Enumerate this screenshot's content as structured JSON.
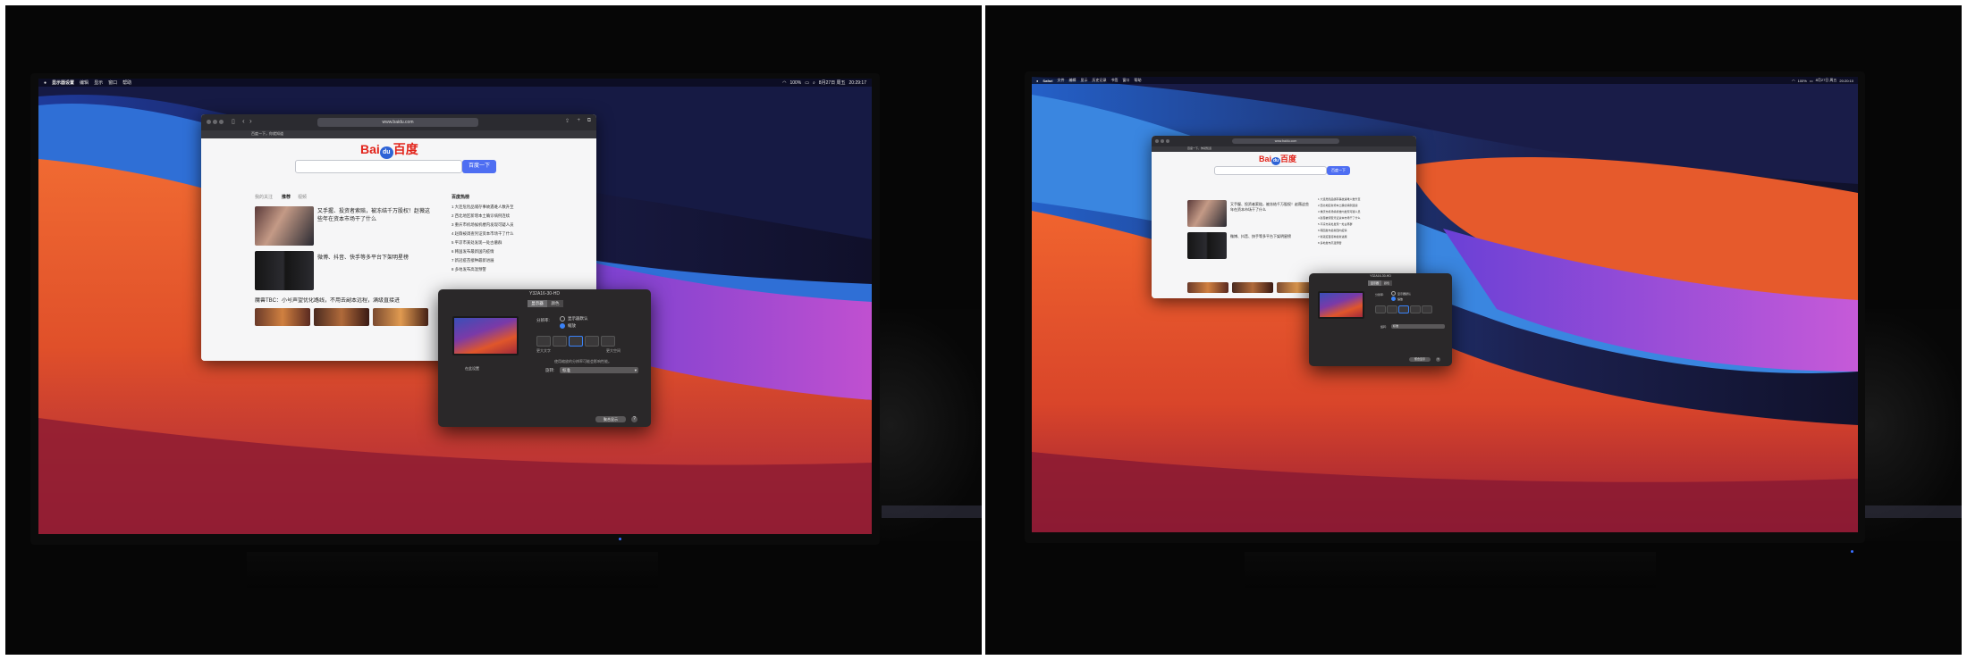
{
  "photos": [
    {
      "id": "left",
      "menubar": {
        "apple_icon": "apple-icon",
        "items": [
          "显示器设置",
          "编辑",
          "显示",
          "窗口",
          "帮助"
        ],
        "status": [
          "100%",
          "8月27日 周五",
          "20:29:17"
        ]
      },
      "browser": {
        "url": "www.baidu.com",
        "tabs": [
          "百度一下，你就知道"
        ],
        "logo": {
          "left": "Bai",
          "mid": "du",
          "right": "百度"
        },
        "search_button": "百度一下",
        "news_tabs": [
          "我的关注",
          "推荐",
          "视频"
        ],
        "hot_title": "百度热榜",
        "news": [
          "又手握、投资者索赔，被冻结千万股权！赵薇这些年在资本市场干了什么",
          "微博、抖音、快手等多平台下架明星榜",
          "魔兽TBC：小号声望优化路线，不用去副本远程，满级直接进"
        ],
        "hot_list": [
          "1 大连危险品储存事故遇难人数升至",
          "2 西北地区新增本土确诊病例连续",
          "3 重庆市机场候机楼内发现可疑人员",
          "4 赵薇被调查凭证资本市场干了什么",
          "5 平凉市某处发现一处古墓群",
          "6 韩国发布最新国内疫情",
          "7 新冠疫苗接种最新进展",
          "8 多地发布高温预警"
        ]
      },
      "dialog": {
        "title": "Y32A16-30-HD",
        "tabs": [
          "显示器",
          "颜色"
        ],
        "label_resolution": "分辨率:",
        "radio_default": "显示器默认",
        "radio_scaled": "缩放",
        "more_space": "更大空间",
        "larger_text": "更大文字",
        "resolution_value": "在此设置",
        "hint": "使用缩放的分辨率可能会影响性能。",
        "label_rotation": "旋转:",
        "rotation_value": "标准",
        "button_detect": "聚合显示",
        "help": "?"
      }
    },
    {
      "id": "right",
      "menubar": {
        "apple_icon": "apple-icon",
        "items": [
          "Safari",
          "文件",
          "编辑",
          "显示",
          "历史记录",
          "书签",
          "窗口",
          "帮助"
        ],
        "status": [
          "100%",
          "8月27日 周五",
          "20:20:10"
        ]
      },
      "browser": {
        "url": "www.baidu.com",
        "tabs": [
          "百度一下，你就知道"
        ],
        "logo": {
          "left": "Bai",
          "mid": "du",
          "right": "百度"
        },
        "search_button": "百度一下",
        "news": [
          "又手握、投资者索赔，被冻结千万股权！赵薇这些年在资本市场干了什么",
          "微博、抖音、快手等多平台下架明星榜"
        ],
        "hot_list": [
          "1 大连危险品储存事故遇难人数升至",
          "2 西北地区新增本土确诊病例连续",
          "3 重庆市机场候机楼内发现可疑人员",
          "4 赵薇被调查凭证资本市场干了什么",
          "5 平凉市某处发现一处古墓群",
          "6 韩国发布最新国内疫情",
          "7 新冠疫苗接种最新进展",
          "8 多地发布高温预警"
        ]
      },
      "dialog": {
        "title": "Y32A16-30-HD",
        "tabs": [
          "显示器",
          "颜色"
        ],
        "label_resolution": "分辨率:",
        "radio_default": "显示器默认",
        "radio_scaled": "缩放",
        "label_rotation": "旋转:",
        "rotation_value": "标准",
        "button_detect": "聚合显示"
      }
    }
  ],
  "colors": {
    "wall_orange": "#e8502a",
    "wall_red": "#b8203a",
    "wall_blue": "#2e6fd4",
    "wall_purple": "#8a3fd0",
    "accent_blue": "#4e6ef2",
    "baidu_red": "#e2231a"
  }
}
